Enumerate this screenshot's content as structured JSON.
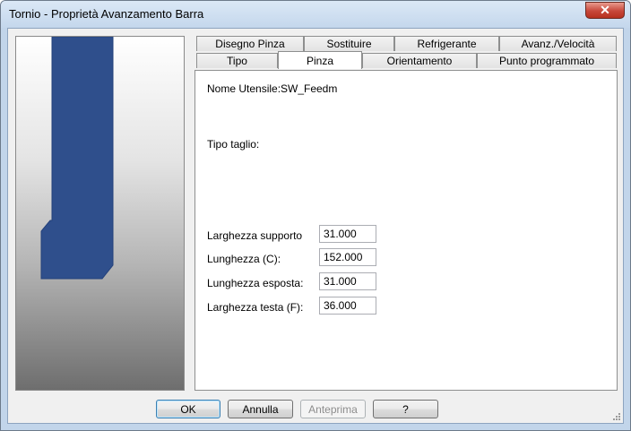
{
  "window": {
    "title": "Tornio - Proprietà Avanzamento Barra"
  },
  "tabs_top": [
    "Disegno Pinza",
    "Sostituire",
    "Refrigerante",
    "Avanz./Velocità"
  ],
  "tabs_bottom": [
    "Tipo",
    "Pinza",
    "Orientamento",
    "Punto programmato"
  ],
  "selected_tab": "Pinza",
  "panel": {
    "tool_name_label": "Nome Utensile:",
    "tool_name_value": "SW_Feedm",
    "cut_type_label": "Tipo taglio:",
    "fields": [
      {
        "label": "Larghezza supporto",
        "value": "31.000"
      },
      {
        "label": "Lunghezza (C):",
        "value": "152.000"
      },
      {
        "label": "Lunghezza esposta:",
        "value": "31.000"
      },
      {
        "label": "Larghezza testa (F):",
        "value": "36.000"
      }
    ]
  },
  "buttons": {
    "ok": "OK",
    "cancel": "Annulla",
    "preview": "Anteprima",
    "help": "?"
  },
  "colors": {
    "holder": "#2f4f8c",
    "holder_outline": "#23407a"
  },
  "icons": {
    "close": "close-icon",
    "resize": "resize-grip-icon"
  }
}
